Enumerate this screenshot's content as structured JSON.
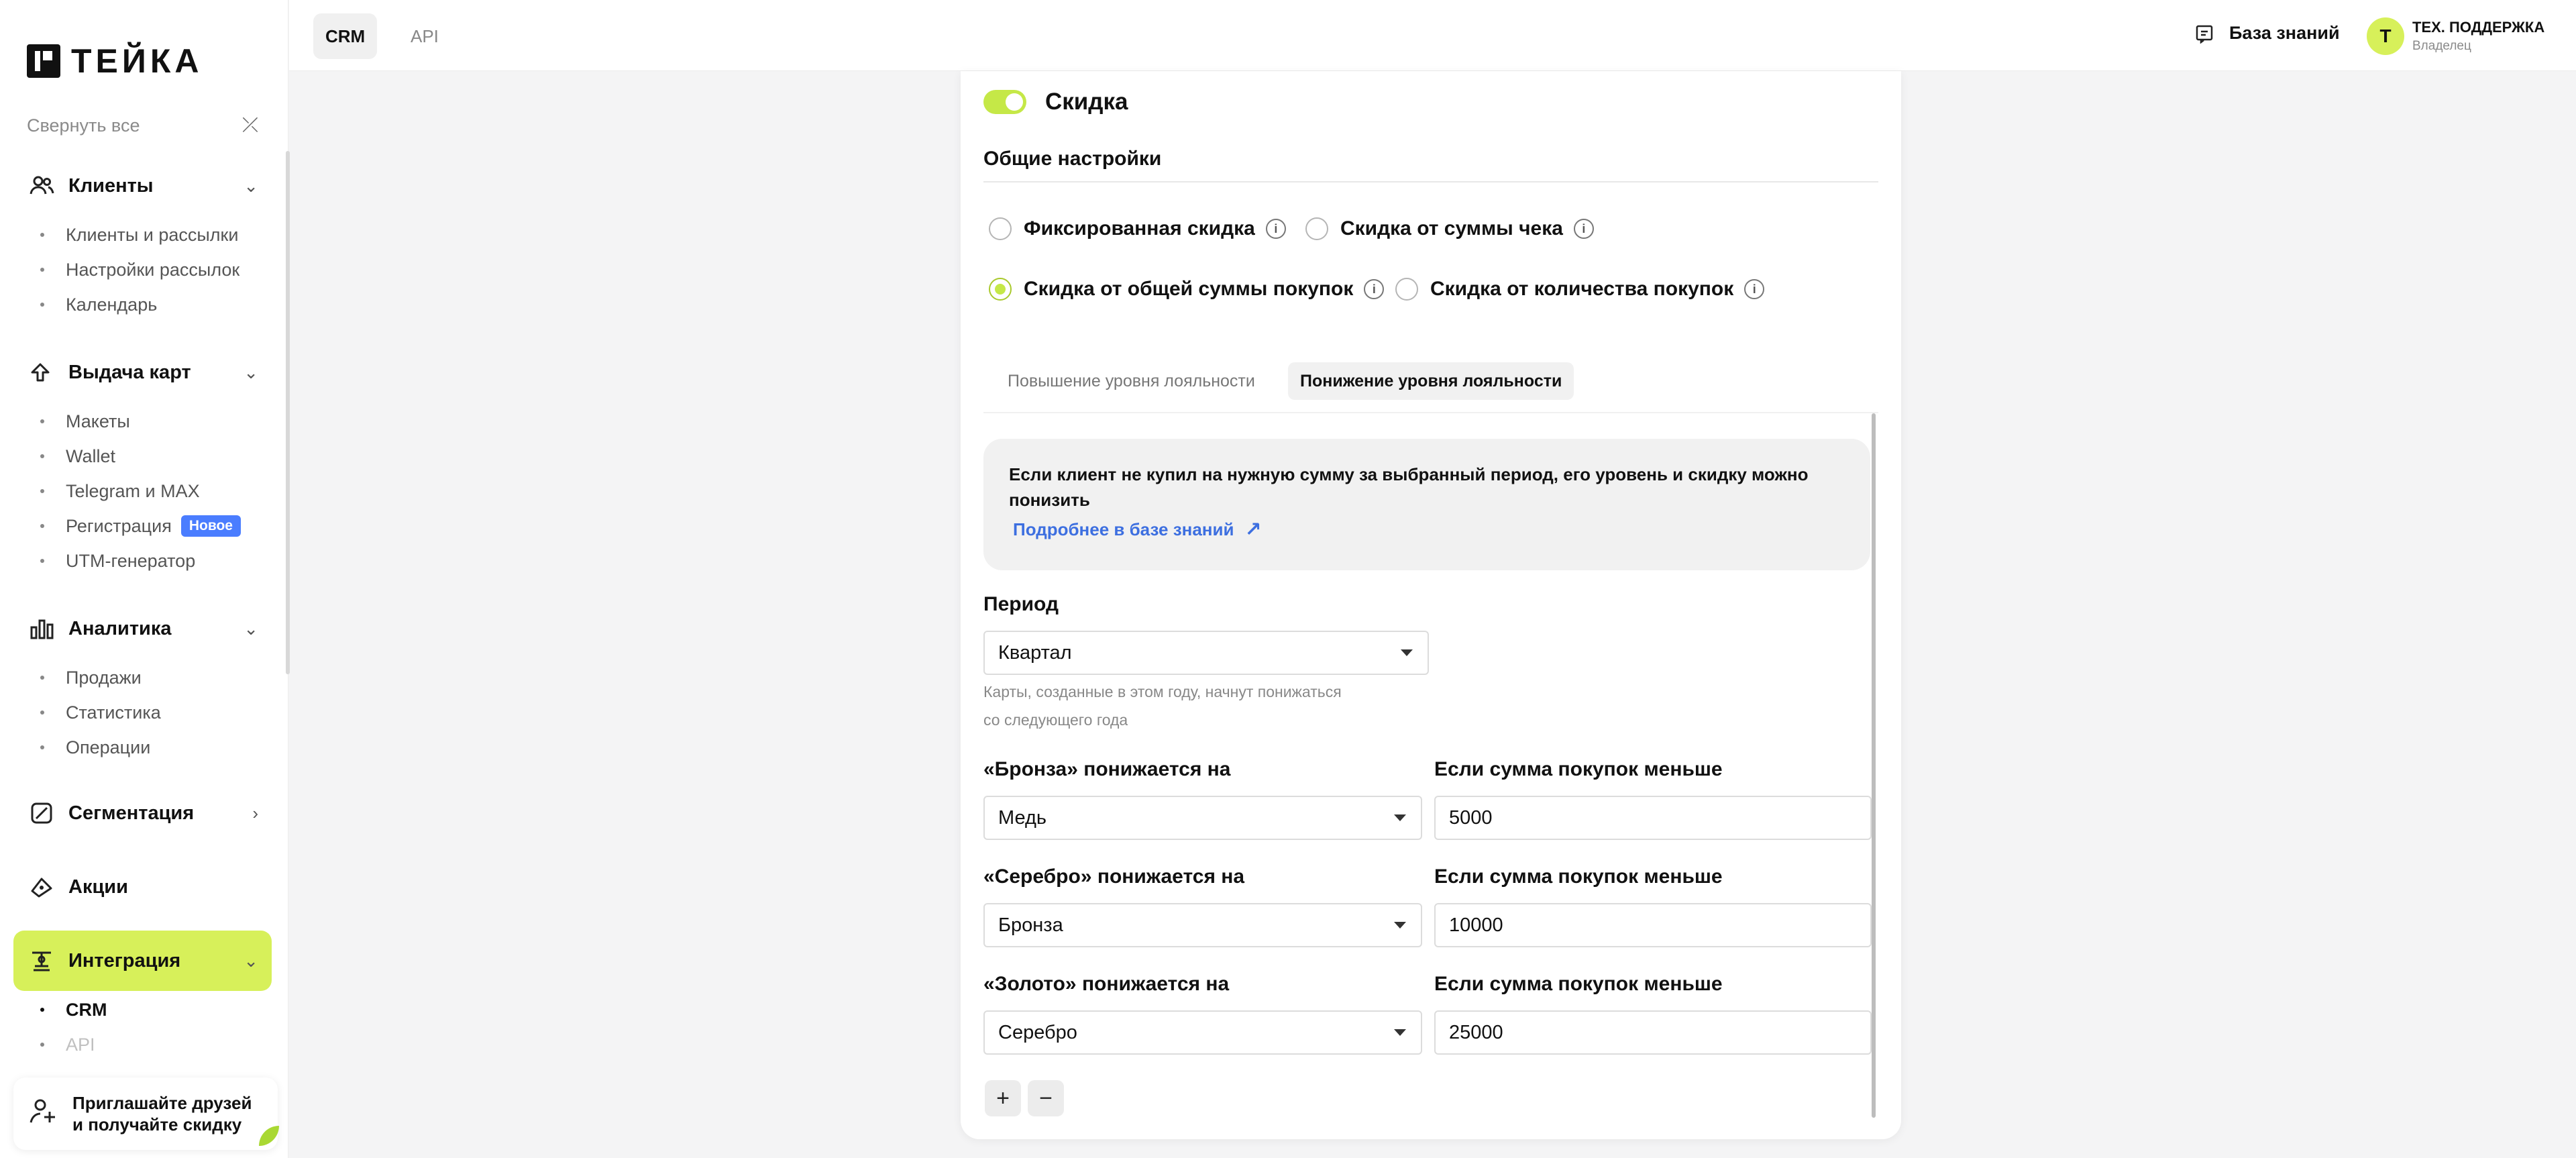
{
  "sidebar": {
    "logo_text": "ТЕЙКА",
    "collapse_label": "Свернуть все",
    "groups": [
      {
        "label": "Клиенты",
        "items": [
          "Клиенты и рассылки",
          "Настройки рассылок",
          "Календарь"
        ]
      },
      {
        "label": "Выдача карт",
        "items": [
          "Макеты",
          "Wallet",
          "Telegram и MAX",
          "Регистрация",
          "UTM-генератор"
        ],
        "badge": "Новое"
      },
      {
        "label": "Аналитика",
        "items": [
          "Продажи",
          "Статистика",
          "Операции"
        ]
      },
      {
        "label": "Сегментация"
      },
      {
        "label": "Акции"
      },
      {
        "label": "Интеграция",
        "items": [
          "CRM",
          "API"
        ]
      }
    ],
    "invite_line1": "Приглашайте друзей",
    "invite_line2": "и получайте скидку",
    "accent_color": "#d7f05a"
  },
  "topbar": {
    "tabs": [
      "CRM",
      "API"
    ],
    "knowledge_base": "База знаний",
    "user_initial": "Т",
    "user_name": "ТЕХ. ПОДДЕРЖКА",
    "user_role": "Владелец"
  },
  "main": {
    "discount_title": "Скидка",
    "toggle_on": true,
    "general_settings": "Общие настройки",
    "radios": [
      {
        "label": "Фиксированная скидка",
        "selected": false
      },
      {
        "label": "Скидка от суммы чека",
        "selected": false
      },
      {
        "label": "Скидка от общей суммы покупок",
        "selected": true
      },
      {
        "label": "Скидка от количества покупок",
        "selected": false
      }
    ],
    "subtabs": [
      "Повышение уровня лояльности",
      "Понижение уровня лояльности"
    ],
    "note_text": "Если клиент не купил на нужную сумму за выбранный период, его уровень и скидку можно понизить",
    "note_link": "Подробнее в базе знаний",
    "period_label": "Период",
    "period_value": "Квартал",
    "period_hint_1": "Карты, созданные в этом году, начнут понижаться",
    "period_hint_2": "со следующего года",
    "rules": [
      {
        "label": "«Бронза» понижается на",
        "target": "Медь",
        "amount_label": "Если сумма покупок меньше",
        "amount": "5000"
      },
      {
        "label": "«Серебро» понижается на",
        "target": "Бронза",
        "amount_label": "Если сумма покупок меньше",
        "amount": "10000"
      },
      {
        "label": "«Золото» понижается на",
        "target": "Серебро",
        "amount_label": "Если сумма покупок меньше",
        "amount": "25000"
      }
    ],
    "add_symbol": "+",
    "remove_symbol": "−"
  }
}
